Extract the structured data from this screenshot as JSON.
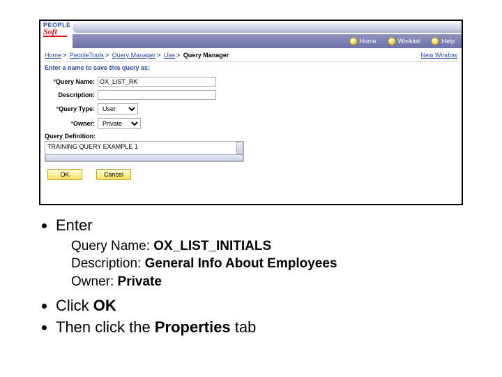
{
  "screenshot": {
    "logo_top": "PEOPLE",
    "logo_bottom": "Soft",
    "nav": {
      "home": "Home",
      "worklist": "Worklist",
      "help": "Help"
    },
    "breadcrumb": {
      "items": [
        "Home",
        "PeopleTools",
        "Query Manager",
        "Use"
      ],
      "last": "Query Manager"
    },
    "new_window": "New Window",
    "prompt": "Enter a name to save this query as:",
    "fields": {
      "query_name_label": "Query Name:",
      "query_name_value": "OX_LIST_RK",
      "description_label": "Description:",
      "description_value": "",
      "query_type_label": "Query Type:",
      "query_type_value": "User",
      "owner_label": "Owner:",
      "owner_value": "Private",
      "definition_label": "Query Definition:",
      "definition_value": "TRAINING QUERY EXAMPLE 1"
    },
    "buttons": {
      "ok": "OK",
      "cancel": "Cancel"
    }
  },
  "slide": {
    "enter": "Enter",
    "line1_a": "Query Name: ",
    "line1_b": "OX_LIST_INITIALS",
    "line2_a": "Description: ",
    "line2_b": "General Info About Employees",
    "line3_a": "Owner: ",
    "line3_b": "Private",
    "step2_a": "Click ",
    "step2_b": "OK",
    "step3_a": "Then click the ",
    "step3_b": "Properties",
    "step3_c": " tab"
  }
}
